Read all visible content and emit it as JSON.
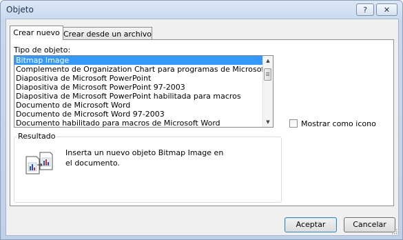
{
  "window": {
    "title": "Objeto",
    "help_label": "?",
    "close_label": "✕"
  },
  "tabs": [
    {
      "label": "Crear nuevo",
      "active": true
    },
    {
      "label": "Crear desde un archivo",
      "active": false
    }
  ],
  "object_type": {
    "label": "Tipo de objeto:",
    "items": [
      "Bitmap Image",
      "Complemento de Organization Chart para programas de Microsoft Office",
      "Diapositiva de Microsoft PowerPoint",
      "Diapositiva de Microsoft PowerPoint 97-2003",
      "Diapositiva de Microsoft PowerPoint habilitada para macros",
      "Documento de Microsoft Word",
      "Documento de Microsoft Word 97-2003",
      "Documento habilitado para macros de Microsoft Word"
    ],
    "selected": "Bitmap Image"
  },
  "display_as_icon": {
    "label": "Mostrar como icono",
    "checked": false
  },
  "result": {
    "title": "Resultado",
    "text": "Inserta un nuevo objeto Bitmap Image en el documento."
  },
  "buttons": {
    "ok": "Aceptar",
    "cancel": "Cancelar"
  },
  "colors": {
    "selection": "#3399ff",
    "accent": "#3c7fb1"
  }
}
